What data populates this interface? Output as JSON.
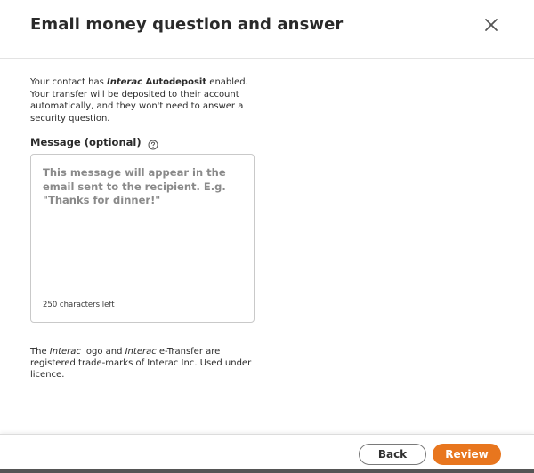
{
  "dialog": {
    "title": "Email money question and answer",
    "close_icon": "close-icon"
  },
  "info": {
    "part1": "Your contact has ",
    "brand": "Interac",
    "feature": " Autodeposit",
    "part2": " enabled. Your transfer will be deposited to their account automatically, and they won't need to answer a security question."
  },
  "message": {
    "label": "Message (optional)",
    "help_icon": "help-circle-icon",
    "value": "",
    "placeholder": "This message will appear in the email sent to the recipient. E.g. \"Thanks for dinner!\"",
    "chars_left": "250 characters left"
  },
  "legal": {
    "part1": "The ",
    "brand1": "Interac",
    "part2": " logo and ",
    "brand2": "Interac",
    "part3": " e-Transfer are registered trade-marks of Interac Inc. Used under licence."
  },
  "footer": {
    "back_label": "Back",
    "review_label": "Review"
  },
  "colors": {
    "accent": "#e8761e",
    "text": "#2a2a2a",
    "border": "#c9c9c9"
  }
}
